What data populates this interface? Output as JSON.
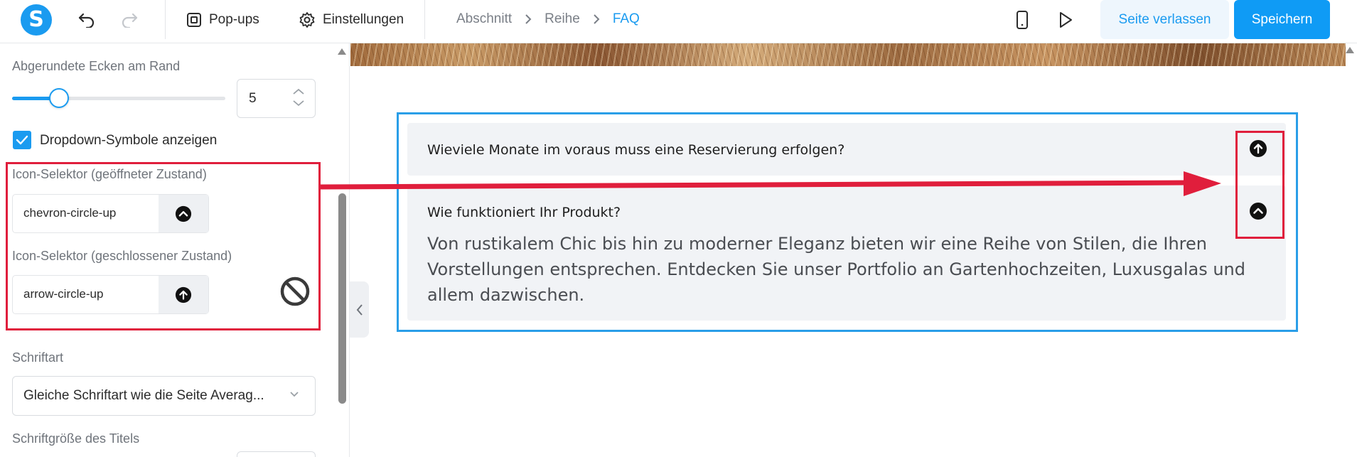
{
  "topbar": {
    "logo_letter": "S",
    "popups_label": "Pop-ups",
    "settings_label": "Einstellungen",
    "breadcrumbs": [
      "Abschnitt",
      "Reihe",
      "FAQ"
    ],
    "leave_label": "Seite verlassen",
    "save_label": "Speichern"
  },
  "panel": {
    "corner_label": "Abgerundete Ecken am Rand",
    "corner_value": "5",
    "corner_slider_fraction": 0.22,
    "dropdown_icons_label": "Dropdown-Symbole anzeigen",
    "dropdown_icons_checked": true,
    "icon_open_label": "Icon-Selektor (geöffneter Zustand)",
    "icon_open_value": "chevron-circle-up",
    "icon_closed_label": "Icon-Selektor (geschlossener Zustand)",
    "icon_closed_value": "arrow-circle-up",
    "font_label": "Schriftart",
    "font_value": "Gleiche Schriftart wie die Seite Averag...",
    "title_size_label": "Schriftgröße des Titels"
  },
  "faq": {
    "items": [
      {
        "question": "Wieviele Monate im voraus muss eine Reservierung erfolgen?",
        "icon": "arrow-circle-up-icon"
      },
      {
        "question": "Wie funktioniert Ihr Produkt?",
        "icon": "chevron-circle-up-icon",
        "answer": "Von rustikalem Chic bis hin zu moderner Eleganz bieten wir eine Reihe von Stilen, die Ihren Vorstellungen entsprechen. Entdecken Sie unser Portfolio an Gartenhochzeiten, Luxusgalas und allem dazwischen."
      }
    ]
  },
  "colors": {
    "accent": "#1a9bf0",
    "annotation": "#e01e3c",
    "panel_bg": "#f1f3f6"
  }
}
